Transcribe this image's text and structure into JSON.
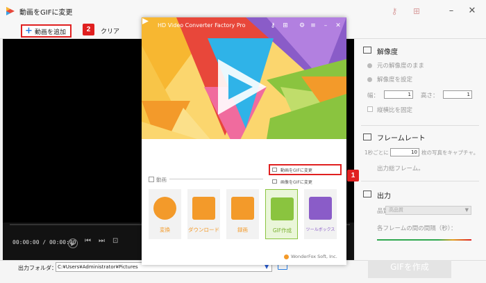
{
  "window": {
    "title": "動画をGIFに変更"
  },
  "toolbar": {
    "add_label": "動画を追加",
    "clear_label": "クリア",
    "badge_add": "2"
  },
  "player": {
    "time": "00:00:00 / 00:00:00"
  },
  "bottom": {
    "output_label": "出力フォルダ：",
    "output_path": "C:¥Users¥Administrator¥Pictures",
    "make_gif": "GIFを作成"
  },
  "right_panel": {
    "resolution_title": "解像度",
    "keep_original": "元の解像度のまま",
    "set_resolution": "解像度を設定",
    "width_label": "幅：",
    "width_value": "1",
    "height_label": "高さ：",
    "height_value": "1",
    "fix_ratio": "縦横比を固定",
    "framerate_title": "フレームレート",
    "per_second_prefix": "1秒ごとに",
    "per_second_value": "10",
    "per_second_suffix": "枚の写真をキャプチャ。",
    "output_frames": "出力総フレーム。",
    "output_title": "出力",
    "quality_label": "品質",
    "quality_value": "高品質",
    "frame_interval": "各フレームの間の間隔（秒）："
  },
  "popup": {
    "title": "HD Video Converter Factory Pro",
    "section_label": "動画",
    "menu_items": [
      "動画をGIFに変更",
      "画像をGIFに変更"
    ],
    "badge_menu": "1",
    "tiles": [
      "変換",
      "ダウンロード",
      "録画",
      "GIF作成",
      "ツールボックス"
    ],
    "footer": "WonderFox Soft, Inc."
  },
  "colors": {
    "accent": "#e02020",
    "brand_blue": "#2a7de1",
    "tile_orange": "#f39a2a",
    "gif_green": "#8ac43f"
  }
}
